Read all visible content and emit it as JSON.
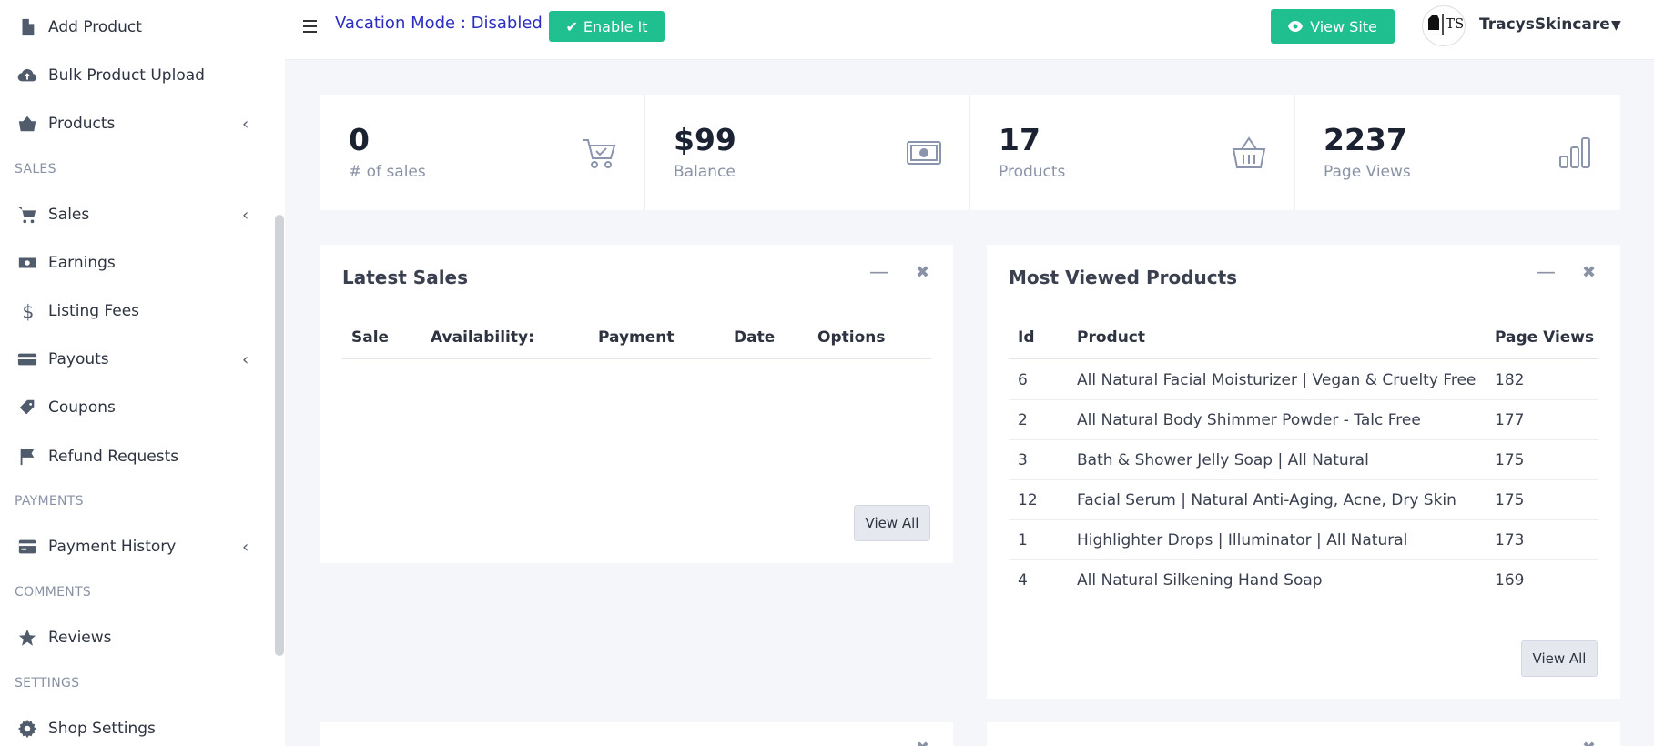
{
  "sidebar": {
    "items": [
      {
        "label": "Add Product",
        "icon": "file-icon"
      },
      {
        "label": "Bulk Product Upload",
        "icon": "cloud-upload-icon"
      },
      {
        "label": "Products",
        "icon": "basket-icon",
        "chevron": "‹"
      },
      {
        "label": "Sales",
        "icon": "cart-icon",
        "chevron": "‹"
      },
      {
        "label": "Earnings",
        "icon": "money-icon"
      },
      {
        "label": "Listing Fees",
        "icon": "dollar-icon"
      },
      {
        "label": "Payouts",
        "icon": "card-icon",
        "chevron": "‹"
      },
      {
        "label": "Coupons",
        "icon": "tag-icon"
      },
      {
        "label": "Refund Requests",
        "icon": "flag-icon"
      },
      {
        "label": "Payment History",
        "icon": "credit-card-icon",
        "chevron": "‹"
      },
      {
        "label": "Reviews",
        "icon": "star-icon"
      },
      {
        "label": "Shop Settings",
        "icon": "gear-icon"
      }
    ],
    "sections": [
      "SALES",
      "PAYMENTS",
      "COMMENTS",
      "SETTINGS"
    ]
  },
  "topbar": {
    "vacation_text": "Vacation Mode : Disabled",
    "enable_label": "Enable It",
    "view_site_label": "View Site",
    "username": "TracysSkincare",
    "avatar_text": "TS"
  },
  "stats": [
    {
      "value": "0",
      "label": "# of sales",
      "icon": "cart-check-icon"
    },
    {
      "value": "$99",
      "label": "Balance",
      "icon": "money-icon"
    },
    {
      "value": "17",
      "label": "Products",
      "icon": "basket-icon"
    },
    {
      "value": "2237",
      "label": "Page Views",
      "icon": "bar-chart-icon"
    }
  ],
  "latest_sales": {
    "title": "Latest Sales",
    "columns": [
      "Sale",
      "Availability:",
      "Payment",
      "Date",
      "Options"
    ],
    "view_all": "View All"
  },
  "most_viewed": {
    "title": "Most Viewed Products",
    "columns": [
      "Id",
      "Product",
      "Page Views"
    ],
    "rows": [
      {
        "id": "6",
        "product": "All Natural Facial Moisturizer | Vegan & Cruelty Free",
        "views": "182"
      },
      {
        "id": "2",
        "product": "All Natural Body Shimmer Powder - Talc Free",
        "views": "177"
      },
      {
        "id": "3",
        "product": "Bath & Shower Jelly Soap | All Natural",
        "views": "175"
      },
      {
        "id": "12",
        "product": "Facial Serum | Natural Anti-Aging, Acne, Dry Skin",
        "views": "175"
      },
      {
        "id": "1",
        "product": "Highlighter Drops | Illuminator | All Natural",
        "views": "173"
      },
      {
        "id": "4",
        "product": "All Natural Silkening Hand Soap",
        "views": "169"
      }
    ],
    "view_all": "View All"
  },
  "colors": {
    "accent": "#1fbf8f",
    "vacation_text": "#2a2fc0"
  }
}
